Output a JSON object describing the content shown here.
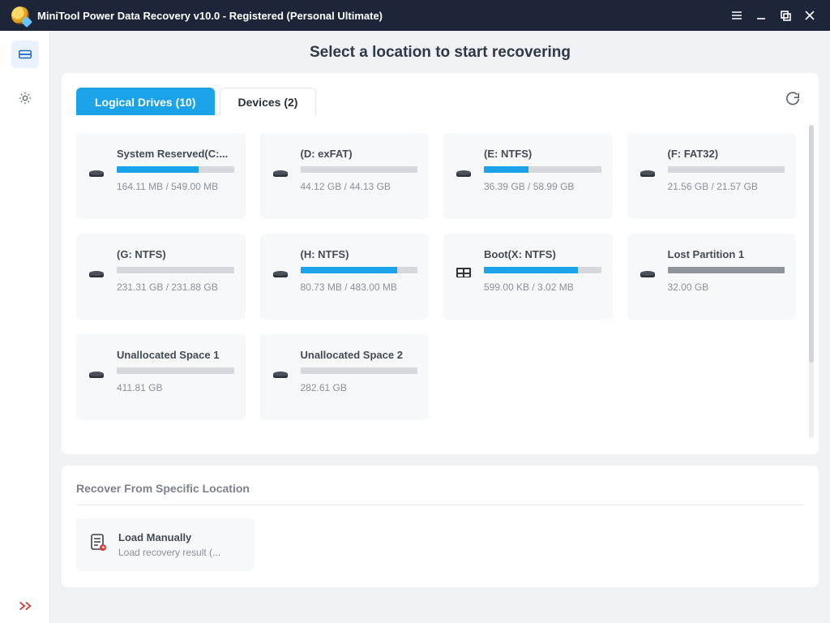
{
  "titlebar": {
    "title": "MiniTool Power Data Recovery v10.0 - Registered (Personal Ultimate)"
  },
  "heading": "Select a location to start recovering",
  "tabs": {
    "logical": "Logical Drives (10)",
    "devices": "Devices (2)"
  },
  "drives": [
    {
      "name": "System Reserved(C:...",
      "size": "164.11 MB / 549.00 MB",
      "fill_pct": 70,
      "lost": false
    },
    {
      "name": "(D: exFAT)",
      "size": "44.12 GB / 44.13 GB",
      "fill_pct": 0,
      "lost": false
    },
    {
      "name": "(E: NTFS)",
      "size": "36.39 GB / 58.99 GB",
      "fill_pct": 38,
      "lost": false
    },
    {
      "name": "(F: FAT32)",
      "size": "21.56 GB / 21.57 GB",
      "fill_pct": 0,
      "lost": false
    },
    {
      "name": "(G: NTFS)",
      "size": "231.31 GB / 231.88 GB",
      "fill_pct": 0,
      "lost": false
    },
    {
      "name": "(H: NTFS)",
      "size": "80.73 MB / 483.00 MB",
      "fill_pct": 83,
      "lost": false
    },
    {
      "name": "Boot(X: NTFS)",
      "size": "599.00 KB / 3.02 MB",
      "fill_pct": 80,
      "lost": false,
      "boot": true
    },
    {
      "name": "Lost Partition 1",
      "size": "32.00 GB",
      "fill_pct": 0,
      "lost": true
    },
    {
      "name": "Unallocated Space 1",
      "size": "411.81 GB",
      "fill_pct": 0,
      "lost": false
    },
    {
      "name": "Unallocated Space 2",
      "size": "282.61 GB",
      "fill_pct": 0,
      "lost": false
    }
  ],
  "recover_section": {
    "title": "Recover From Specific Location",
    "load_manually": {
      "title": "Load Manually",
      "subtitle": "Load recovery result (..."
    }
  }
}
